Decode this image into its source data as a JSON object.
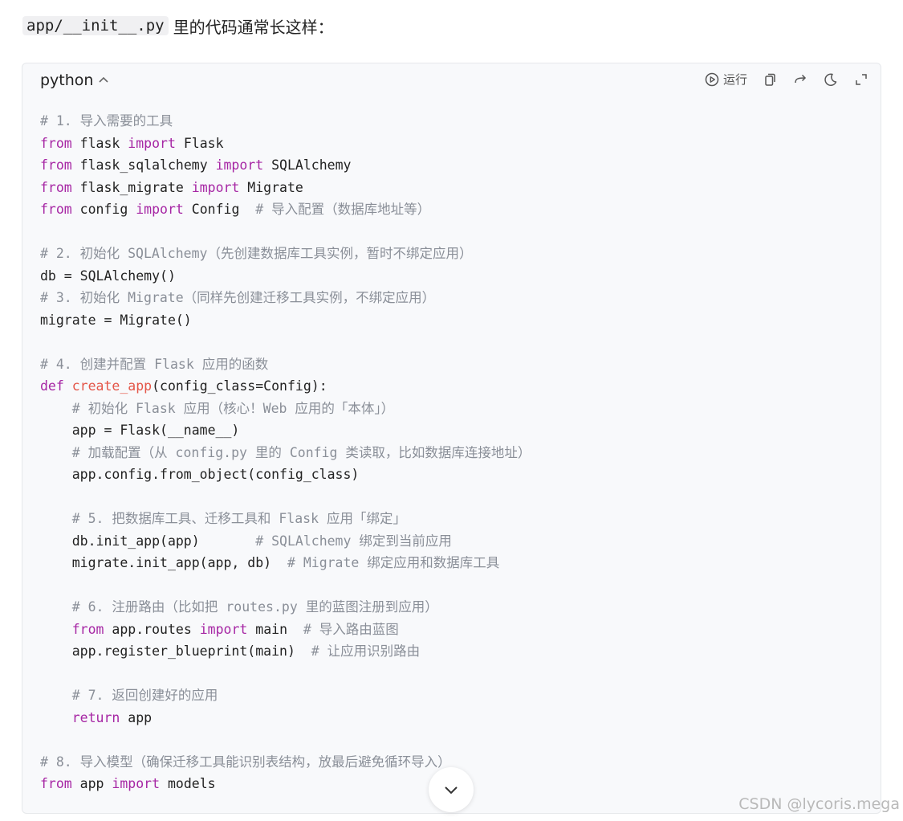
{
  "intro": {
    "code": "app/__init__.py",
    "text": "里的代码通常长这样："
  },
  "code_block": {
    "language": "python",
    "run_label": "运行",
    "lines": [
      [
        {
          "t": "# 1. 导入需要的工具",
          "k": "cm"
        }
      ],
      [
        {
          "t": "from",
          "k": "kw"
        },
        {
          "t": " flask "
        },
        {
          "t": "import",
          "k": "kw"
        },
        {
          "t": " Flask"
        }
      ],
      [
        {
          "t": "from",
          "k": "kw"
        },
        {
          "t": " flask_sqlalchemy "
        },
        {
          "t": "import",
          "k": "kw"
        },
        {
          "t": " SQLAlchemy"
        }
      ],
      [
        {
          "t": "from",
          "k": "kw"
        },
        {
          "t": " flask_migrate "
        },
        {
          "t": "import",
          "k": "kw"
        },
        {
          "t": " Migrate"
        }
      ],
      [
        {
          "t": "from",
          "k": "kw"
        },
        {
          "t": " config "
        },
        {
          "t": "import",
          "k": "kw"
        },
        {
          "t": " Config  "
        },
        {
          "t": "# 导入配置（数据库地址等）",
          "k": "cm"
        }
      ],
      [],
      [
        {
          "t": "# 2. 初始化 SQLAlchemy（先创建数据库工具实例，暂时不绑定应用）",
          "k": "cm"
        }
      ],
      [
        {
          "t": "db = SQLAlchemy()"
        }
      ],
      [
        {
          "t": "# 3. 初始化 Migrate（同样先创建迁移工具实例，不绑定应用）",
          "k": "cm"
        }
      ],
      [
        {
          "t": "migrate = Migrate()"
        }
      ],
      [],
      [
        {
          "t": "# 4. 创建并配置 Flask 应用的函数",
          "k": "cm"
        }
      ],
      [
        {
          "t": "def",
          "k": "kw"
        },
        {
          "t": " "
        },
        {
          "t": "create_app",
          "k": "fn"
        },
        {
          "t": "(config_class=Config):"
        }
      ],
      [
        {
          "t": "    "
        },
        {
          "t": "# 初始化 Flask 应用（核心！Web 应用的「本体」）",
          "k": "cm"
        }
      ],
      [
        {
          "t": "    app = Flask(__name__)"
        }
      ],
      [
        {
          "t": "    "
        },
        {
          "t": "# 加载配置（从 config.py 里的 Config 类读取，比如数据库连接地址）",
          "k": "cm"
        }
      ],
      [
        {
          "t": "    app.config.from_object(config_class)"
        }
      ],
      [],
      [
        {
          "t": "    "
        },
        {
          "t": "# 5. 把数据库工具、迁移工具和 Flask 应用「绑定」",
          "k": "cm"
        }
      ],
      [
        {
          "t": "    db.init_app(app)       "
        },
        {
          "t": "# SQLAlchemy 绑定到当前应用",
          "k": "cm"
        }
      ],
      [
        {
          "t": "    migrate.init_app(app, db)  "
        },
        {
          "t": "# Migrate 绑定应用和数据库工具",
          "k": "cm"
        }
      ],
      [],
      [
        {
          "t": "    "
        },
        {
          "t": "# 6. 注册路由（比如把 routes.py 里的蓝图注册到应用）",
          "k": "cm"
        }
      ],
      [
        {
          "t": "    "
        },
        {
          "t": "from",
          "k": "kw"
        },
        {
          "t": " app.routes "
        },
        {
          "t": "import",
          "k": "kw"
        },
        {
          "t": " main  "
        },
        {
          "t": "# 导入路由蓝图",
          "k": "cm"
        }
      ],
      [
        {
          "t": "    app.register_blueprint(main)  "
        },
        {
          "t": "# 让应用识别路由",
          "k": "cm"
        }
      ],
      [],
      [
        {
          "t": "    "
        },
        {
          "t": "# 7. 返回创建好的应用",
          "k": "cm"
        }
      ],
      [
        {
          "t": "    "
        },
        {
          "t": "return",
          "k": "kw"
        },
        {
          "t": " app"
        }
      ],
      [],
      [
        {
          "t": "# 8. 导入模型（确保迁移工具能识别表结构，放最后避免循环导入）",
          "k": "cm"
        }
      ],
      [
        {
          "t": "from",
          "k": "kw"
        },
        {
          "t": " app "
        },
        {
          "t": "import",
          "k": "kw"
        },
        {
          "t": " models"
        }
      ]
    ]
  },
  "watermark": "CSDN @lycoris.mega",
  "icons": {
    "caret": "chevron-up-icon",
    "run": "play-circle-icon",
    "copy": "copy-icon",
    "share": "redo-arrow-icon",
    "theme": "moon-icon",
    "fullscreen": "fullscreen-icon",
    "expand": "chevron-down-icon"
  },
  "colors": {
    "keyword": "#a626a4",
    "function": "#e45649",
    "comment": "#8a8f98",
    "code_bg": "#f8f9fb"
  }
}
